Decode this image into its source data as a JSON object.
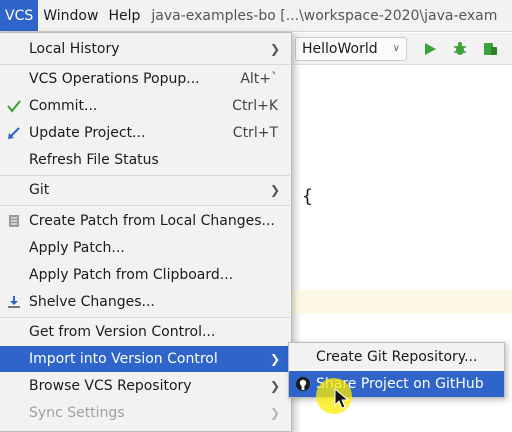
{
  "menubar": {
    "vcs": "VCS",
    "window": "Window",
    "help": "Help",
    "title": "java-examples-bo [...\\workspace-2020\\java-exam"
  },
  "toolbar": {
    "run_config": "HelloWorld",
    "run_icon": "run-icon",
    "debug_icon": "debug-icon",
    "coverage_icon": "coverage-icon"
  },
  "editor": {
    "brace": "{"
  },
  "vcs_menu": {
    "items": [
      {
        "label": "Local History",
        "shortcut": "",
        "submenu": true
      },
      {
        "label": "VCS Operations Popup...",
        "shortcut": "Alt+`"
      },
      {
        "label": "Commit...",
        "shortcut": "Ctrl+K",
        "icon": "check-icon"
      },
      {
        "label": "Update Project...",
        "shortcut": "Ctrl+T",
        "icon": "update-arrow-icon"
      },
      {
        "label": "Refresh File Status",
        "shortcut": ""
      },
      {
        "label": "Git",
        "shortcut": "",
        "submenu": true
      },
      {
        "label": "Create Patch from Local Changes...",
        "shortcut": "",
        "icon": "patch-icon"
      },
      {
        "label": "Apply Patch...",
        "shortcut": ""
      },
      {
        "label": "Apply Patch from Clipboard...",
        "shortcut": ""
      },
      {
        "label": "Shelve Changes...",
        "shortcut": "",
        "icon": "shelve-icon"
      },
      {
        "label": "Get from Version Control...",
        "shortcut": ""
      },
      {
        "label": "Import into Version Control",
        "shortcut": "",
        "submenu": true,
        "selected": true
      },
      {
        "label": "Browse VCS Repository",
        "shortcut": "",
        "submenu": true
      },
      {
        "label": "Sync Settings",
        "shortcut": "",
        "submenu": true,
        "disabled": true
      }
    ]
  },
  "import_submenu": {
    "items": [
      {
        "label": "Create Git Repository..."
      },
      {
        "label": "Share Project on GitHub",
        "icon": "github-icon",
        "selected": true
      }
    ]
  },
  "colors": {
    "selection": "#2f65ca",
    "menu_bg": "#f2f2f2",
    "run_green": "#3ba236",
    "cursor_highlight": "#ffec00"
  }
}
